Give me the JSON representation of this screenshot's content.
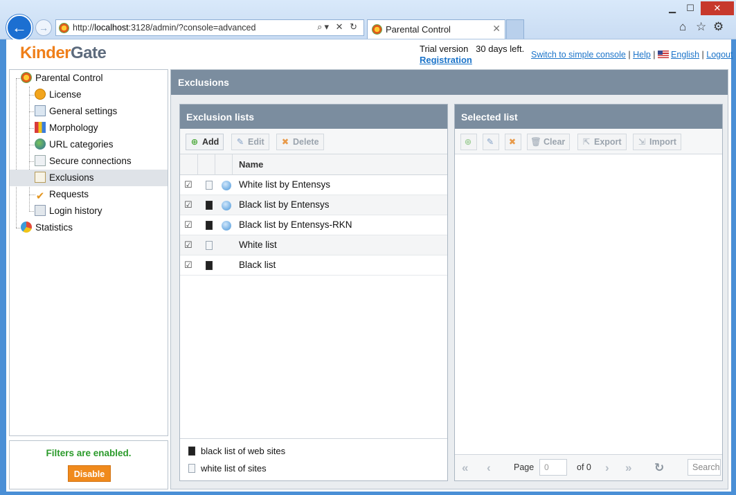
{
  "browser": {
    "url_prefix": "http://",
    "url_host": "localhost",
    "url_rest": ":3128/admin/?console=advanced",
    "tab_title": "Parental Control"
  },
  "header": {
    "logo_part1": "Kinder",
    "logo_part2": "Gate",
    "trial_text": "Trial version   30 days left.",
    "registration": "Registration",
    "switch_console": "Switch to simple console",
    "help": "Help",
    "language": "English",
    "logout": "Logout",
    "separator": "|"
  },
  "tree": {
    "root": "Parental Control",
    "items": [
      "License",
      "General settings",
      "Morphology",
      "URL categories",
      "Secure connections",
      "Exclusions",
      "Requests",
      "Login history"
    ],
    "selected": "Exclusions",
    "statistics": "Statistics"
  },
  "status": {
    "text": "Filters are enabled.",
    "button": "Disable"
  },
  "main": {
    "title": "Exclusions",
    "left_panel": {
      "title": "Exclusion lists",
      "toolbar": [
        "Add",
        "Edit",
        "Delete"
      ],
      "column_name": "Name",
      "rows": [
        {
          "name": "White list by Entensys",
          "type": "white",
          "global": true
        },
        {
          "name": "Black list by Entensys",
          "type": "black",
          "global": true
        },
        {
          "name": "Black list by Entensys-RKN",
          "type": "black",
          "global": true
        },
        {
          "name": "White list",
          "type": "white",
          "global": false
        },
        {
          "name": "Black list",
          "type": "black",
          "global": false
        }
      ],
      "legend": [
        "black list of web sites",
        "white list of sites"
      ]
    },
    "right_panel": {
      "title": "Selected list",
      "toolbar": [
        "Clear",
        "Export",
        "Import"
      ],
      "pager": {
        "page_label": "Page",
        "page_value": "0",
        "of_label": "of 0",
        "search_placeholder": "Search"
      }
    }
  },
  "colors": {
    "accent_orange": "#f08a1c",
    "header_slate": "#7b8d9f",
    "status_green": "#2a9a2a",
    "link_blue": "#1a73c9"
  }
}
